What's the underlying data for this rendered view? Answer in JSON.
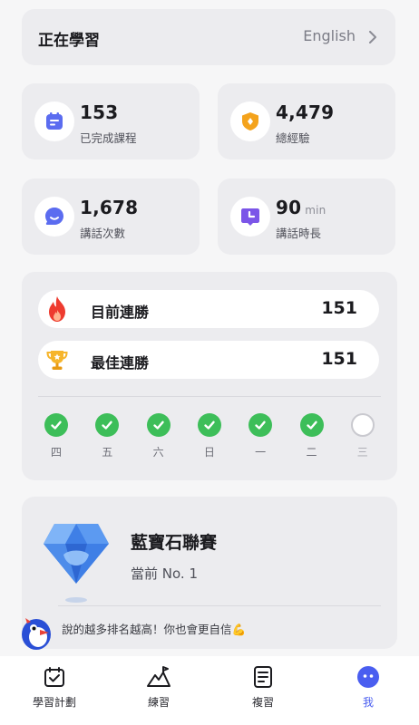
{
  "learning": {
    "title": "正在學習",
    "language": "English"
  },
  "stats": [
    {
      "value": "153",
      "unit": "",
      "label": "已完成課程",
      "icon": "calendar-icon"
    },
    {
      "value": "4,479",
      "unit": "",
      "label": "總經驗",
      "icon": "xp-shield-icon"
    },
    {
      "value": "1,678",
      "unit": "",
      "label": "講話次數",
      "icon": "speech-bubble-icon"
    },
    {
      "value": "90",
      "unit": "min",
      "label": "講話時長",
      "icon": "clock-bubble-icon"
    }
  ],
  "streak": {
    "current_label": "目前連勝",
    "current_value": "151",
    "best_label": "最佳連勝",
    "best_value": "151",
    "days": [
      {
        "label": "四",
        "done": true
      },
      {
        "label": "五",
        "done": true
      },
      {
        "label": "六",
        "done": true
      },
      {
        "label": "日",
        "done": true
      },
      {
        "label": "一",
        "done": true
      },
      {
        "label": "二",
        "done": true
      },
      {
        "label": "三",
        "done": false
      }
    ]
  },
  "league": {
    "name": "藍寶石聯賽",
    "rank": "當前 No. 1",
    "message": "說的越多排名越高！你也會更自信💪"
  },
  "nav": [
    {
      "label": "學習計劃",
      "icon": "plan-icon",
      "active": false
    },
    {
      "label": "練習",
      "icon": "mountain-icon",
      "active": false
    },
    {
      "label": "複習",
      "icon": "review-icon",
      "active": false
    },
    {
      "label": "我",
      "icon": "profile-icon",
      "active": true
    }
  ],
  "colors": {
    "accent": "#4a5ef0",
    "check": "#3dbe59",
    "gold": "#f4a31c",
    "purple": "#7b55e8"
  }
}
